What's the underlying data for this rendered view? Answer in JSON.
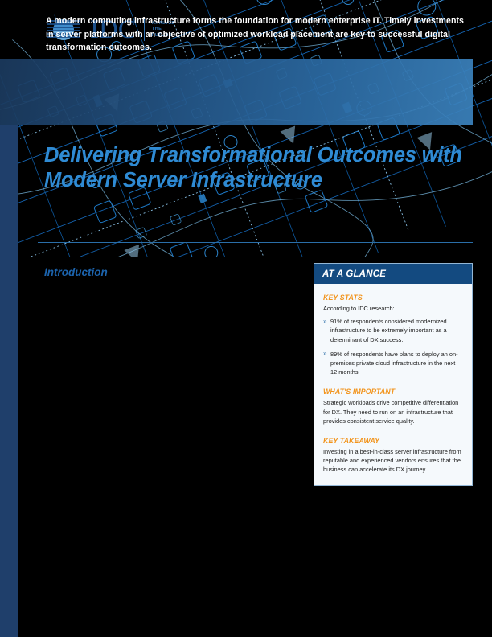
{
  "brand": {
    "logo_word": "IDC",
    "logo_tagline": "ANALYZE\nTHE\nFUTURE",
    "logo_mark_icon": "idc-striped-globe-icon",
    "accent_blue": "#2f8bd4",
    "deep_navy": "#1f3f6b",
    "orange": "#f2941c",
    "header_blue": "#134a80"
  },
  "banner": {
    "text": "A modern computing infrastructure forms the foundation for modern enterprise IT. Timely investments in server platforms with an objective of optimized workload placement are key to successful digital transformation outcomes."
  },
  "title": {
    "text": "Delivering Transformational Outcomes with Modern Server Infrastructure"
  },
  "body": {
    "intro_heading": "Introduction"
  },
  "glance": {
    "header": "AT A GLANCE",
    "sections": [
      {
        "title": "KEY STATS",
        "lead": "According to IDC research:",
        "bullet_glyph": "»",
        "items": [
          "91% of respondents considered modernized infrastructure to be extremely important as a determinant of DX success.",
          "89% of respondents have plans to deploy an on-premises private cloud infrastructure in the next 12 months."
        ]
      },
      {
        "title": "WHAT'S IMPORTANT",
        "text": "Strategic workloads drive competitive differentiation for DX. They need to run on an infrastructure that provides consistent service quality."
      },
      {
        "title": "KEY TAKEAWAY",
        "text": "Investing in a best-in-class server infrastructure from reputable and experienced vendors ensures that the business can accelerate its DX journey."
      }
    ]
  }
}
